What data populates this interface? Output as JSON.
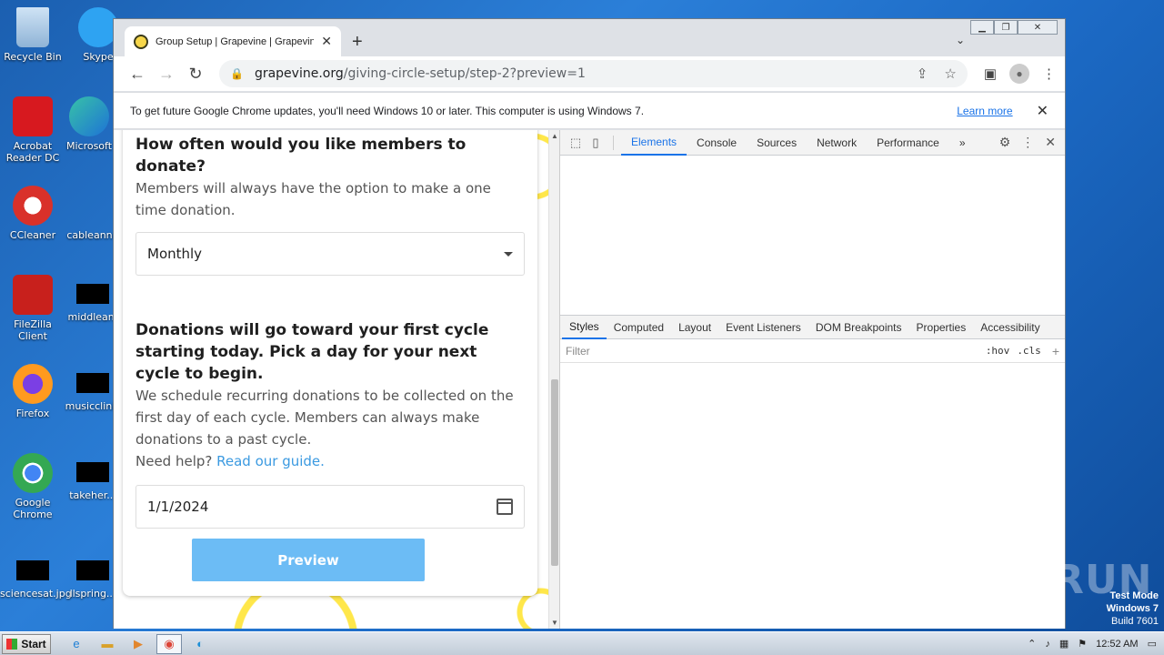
{
  "desktop": {
    "icons": [
      {
        "label": "Recycle Bin"
      },
      {
        "label": "Skype"
      },
      {
        "label": "Acrobat Reader DC"
      },
      {
        "label": "Microsoft"
      },
      {
        "label": "CCleaner"
      },
      {
        "label": "cableannu"
      },
      {
        "label": "FileZilla Client"
      },
      {
        "label": "middleam"
      },
      {
        "label": "Firefox"
      },
      {
        "label": "musicclinic"
      },
      {
        "label": "Google Chrome"
      },
      {
        "label": "takeher..."
      },
      {
        "label": "sciencesat.jpg"
      },
      {
        "label": "llspring..."
      }
    ]
  },
  "browser": {
    "tab_title": "Group Setup | Grapevine | Grapevine",
    "url_host": "grapevine.org",
    "url_path": "/giving-circle-setup/step-2?preview=1",
    "infobar_message": "To get future Google Chrome updates, you'll need Windows 10 or later. This computer is using Windows 7.",
    "infobar_link": "Learn more"
  },
  "page": {
    "q1_title": "How often would you like members to donate?",
    "q1_sub": "Members will always have the option to make a one time donation.",
    "frequency_value": "Monthly",
    "q2_title": "Donations will go toward your first cycle starting today. Pick a day for your next cycle to begin.",
    "q2_sub": "We schedule recurring donations to be collected on the first day of each cycle. Members can always make donations to a past cycle.",
    "help_prefix": "Need help?",
    "help_link": "Read our guide.",
    "date_value": "1/1/2024",
    "preview_button": "Preview"
  },
  "devtools": {
    "tabs": [
      "Elements",
      "Console",
      "Sources",
      "Network",
      "Performance"
    ],
    "more": "»",
    "style_tabs": [
      "Styles",
      "Computed",
      "Layout",
      "Event Listeners",
      "DOM Breakpoints",
      "Properties",
      "Accessibility"
    ],
    "filter_placeholder": "Filter",
    "hov": ":hov",
    "cls": ".cls",
    "plus": "+"
  },
  "watermark": {
    "text": "ANY RUN"
  },
  "testmode": {
    "line1": "Test Mode",
    "line2": "Windows 7",
    "line3": "Build 7601"
  },
  "taskbar": {
    "start_label": "Start",
    "clock": "12:52 AM"
  },
  "colors": {
    "accent": "#1a73e8",
    "preview_button": "#6cbcf5",
    "link": "#3b9ae1"
  }
}
